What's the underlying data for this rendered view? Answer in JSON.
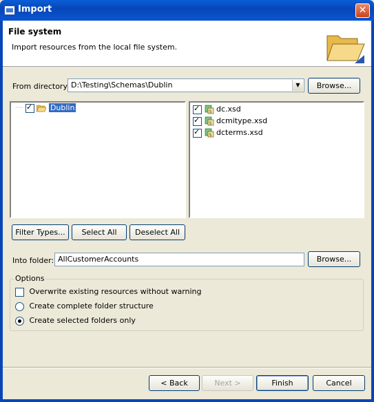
{
  "window": {
    "title": "Import",
    "close_glyph": "✕"
  },
  "banner": {
    "title": "File system",
    "description": "Import resources from the local file system."
  },
  "from_directory": {
    "label": "From directory:",
    "value": "D:\\Testing\\Schemas\\Dublin",
    "browse_label": "Browse..."
  },
  "tree": {
    "items": [
      {
        "label": "Dublin",
        "checked": true,
        "selected": true
      }
    ]
  },
  "files": {
    "items": [
      {
        "name": "dc.xsd",
        "checked": true
      },
      {
        "name": "dcmitype.xsd",
        "checked": true
      },
      {
        "name": "dcterms.xsd",
        "checked": true
      }
    ]
  },
  "selection_buttons": {
    "filter_types": "Filter Types...",
    "select_all": "Select All",
    "deselect_all": "Deselect All"
  },
  "into_folder": {
    "label": "Into folder:",
    "value": "AllCustomerAccounts",
    "browse_label": "Browse..."
  },
  "options": {
    "legend": "Options",
    "overwrite_label": "Overwrite existing resources without warning",
    "overwrite_checked": false,
    "radio_complete_label": "Create complete folder structure",
    "radio_selected_label": "Create selected folders only",
    "selected_radio": "selected"
  },
  "footer": {
    "back": "< Back",
    "next": "Next >",
    "finish": "Finish",
    "cancel": "Cancel"
  },
  "colors": {
    "titlebar": "#0a55d0",
    "selection": "#316ac5",
    "dialog_bg": "#ece9d8"
  }
}
